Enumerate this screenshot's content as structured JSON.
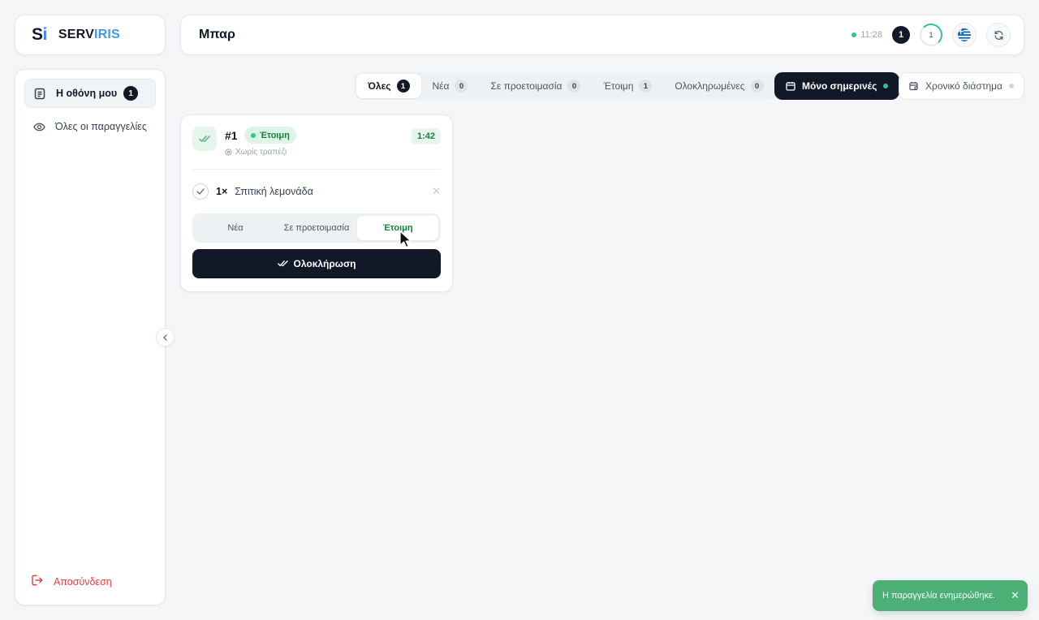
{
  "brand": {
    "mark_s": "S",
    "mark_i": "i",
    "name_a": "SERV",
    "name_b": "IRIS"
  },
  "header": {
    "title": "Μπαρ",
    "time": "11:28",
    "notification_count": "1",
    "progress_count": "1",
    "language_icon": "greek-flag-icon",
    "refresh_icon": "refresh-icon"
  },
  "sidebar": {
    "items": [
      {
        "label": "Η οθόνη μου",
        "badge": "1",
        "icon": "clipboard-icon",
        "active": true
      },
      {
        "label": "Όλες οι παραγγελίες",
        "icon": "eye-icon",
        "active": false
      }
    ],
    "logout_label": "Αποσύνδεση"
  },
  "filters": {
    "tabs": [
      {
        "label": "Όλες",
        "count": "1",
        "active": true
      },
      {
        "label": "Νέα",
        "count": "0"
      },
      {
        "label": "Σε προετοιμασία",
        "count": "0"
      },
      {
        "label": "Έτοιμη",
        "count": "1"
      },
      {
        "label": "Ολοκληρωμένες",
        "count": "0"
      }
    ],
    "today_label": "Μόνο σημερινές",
    "range_label": "Χρονικό διάστημα"
  },
  "order": {
    "number": "#1",
    "status": "Έτοιμη",
    "table": "Χωρίς τραπέζι",
    "timer": "1:42",
    "items": [
      {
        "qty": "1×",
        "name": "Σπιτική λεμονάδα"
      }
    ],
    "segments": [
      "Νέα",
      "Σε προετοιμασία",
      "Έτοιμη"
    ],
    "active_segment": "Έτοιμη",
    "complete_label": "Ολοκλήρωση"
  },
  "toast": {
    "message": "Η παραγγελία ενημερώθηκε.",
    "close": "✕"
  },
  "colors": {
    "accent_dark": "#111827",
    "success": "#34c38f",
    "success_text": "#15803d",
    "danger": "#e53e3e",
    "toast_bg": "#4caf76"
  }
}
